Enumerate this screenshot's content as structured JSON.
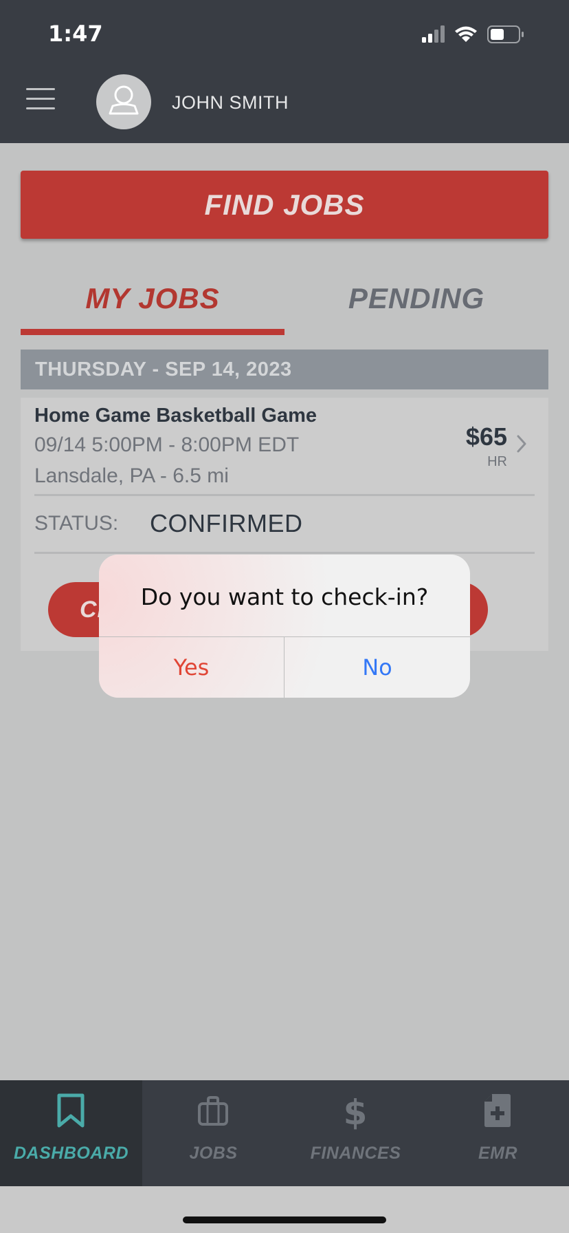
{
  "status_bar": {
    "time": "1:47"
  },
  "header": {
    "user_name": "JOHN SMITH"
  },
  "find_jobs_label": "FIND JOBS",
  "tabs": [
    {
      "label": "MY JOBS",
      "active": true
    },
    {
      "label": "PENDING",
      "active": false
    }
  ],
  "date_header": "THURSDAY - SEP 14, 2023",
  "job": {
    "title": "Home Game Basketball Game",
    "time": "09/14 5:00PM  - 8:00PM EDT",
    "location": "Lansdale, PA - 6.5 mi",
    "rate": "$65",
    "rate_unit": "HR",
    "status_label": "STATUS:",
    "status_value": "CONFIRMED",
    "action_label_visible": "CH"
  },
  "dialog": {
    "title": "Do you want to check-in?",
    "yes_label": "Yes",
    "no_label": "No"
  },
  "tab_bar": [
    {
      "label": "DASHBOARD",
      "icon": "bookmark-icon",
      "active": true
    },
    {
      "label": "JOBS",
      "icon": "briefcase-icon",
      "active": false
    },
    {
      "label": "FINANCES",
      "icon": "dollar-icon",
      "active": false
    },
    {
      "label": "EMR",
      "icon": "medical-document-icon",
      "active": false
    }
  ],
  "colors": {
    "brand_red": "#bc3934",
    "header_dark": "#393d44",
    "accent_teal": "#4aaba9",
    "dialog_yes": "#e04535",
    "dialog_no": "#3478f6"
  }
}
